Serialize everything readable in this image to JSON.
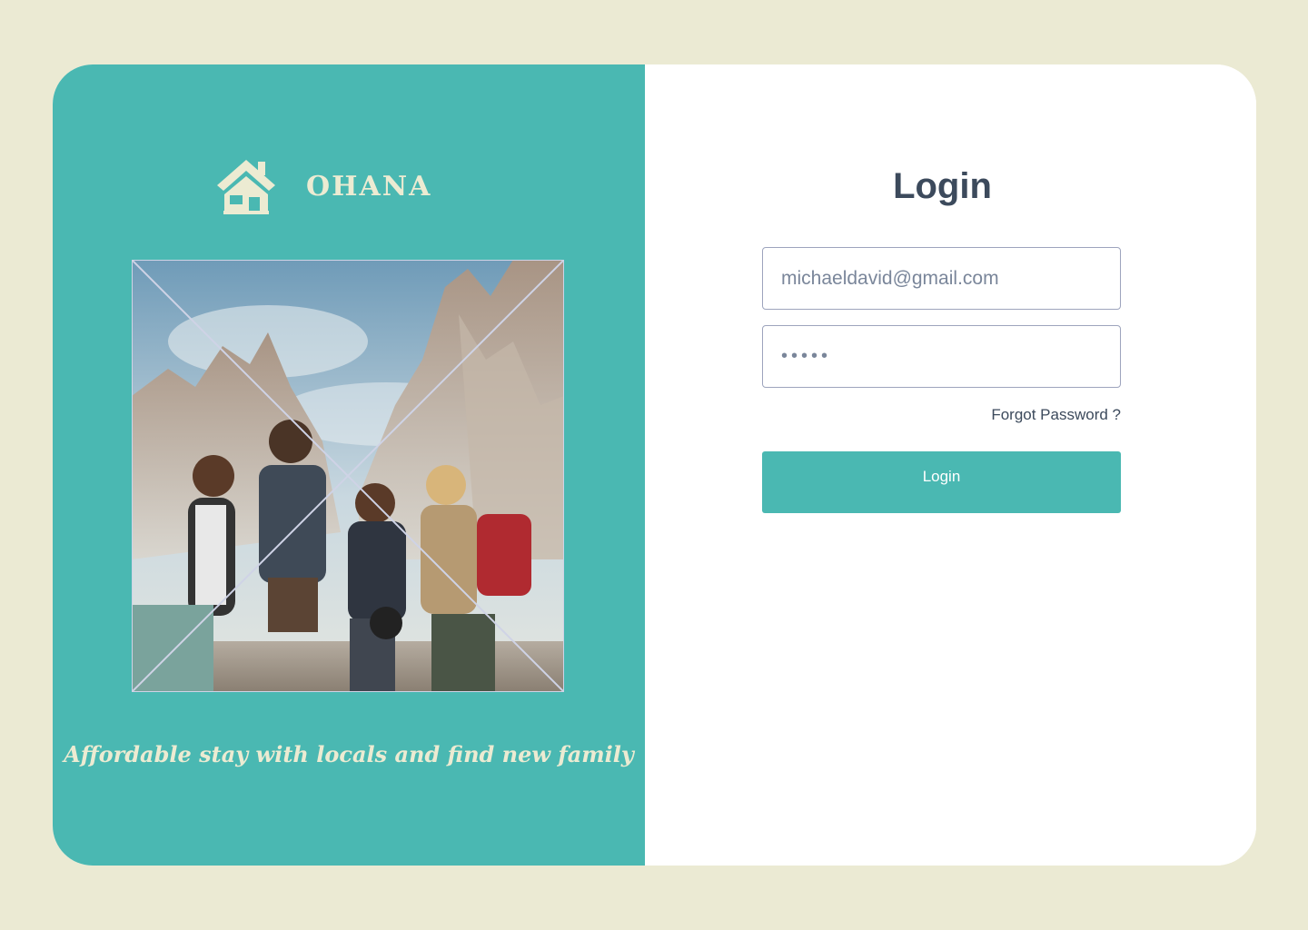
{
  "brand": {
    "name": "OHANA",
    "icon": "house-icon"
  },
  "hero": {
    "image": "hikers-group-photo"
  },
  "tagline": "Affordable stay with locals and find new family",
  "login": {
    "title": "Login",
    "email_value": "michaeldavid@gmail.com",
    "password_masked": "•••••",
    "forgot_label": "Forgot Password ?",
    "button_label": "Login"
  },
  "colors": {
    "page_background": "#ebead3",
    "accent": "#4ab8b2",
    "brand_text": "#ecebd2",
    "heading_text": "#3c4a5c",
    "input_border": "#9da4bd"
  }
}
